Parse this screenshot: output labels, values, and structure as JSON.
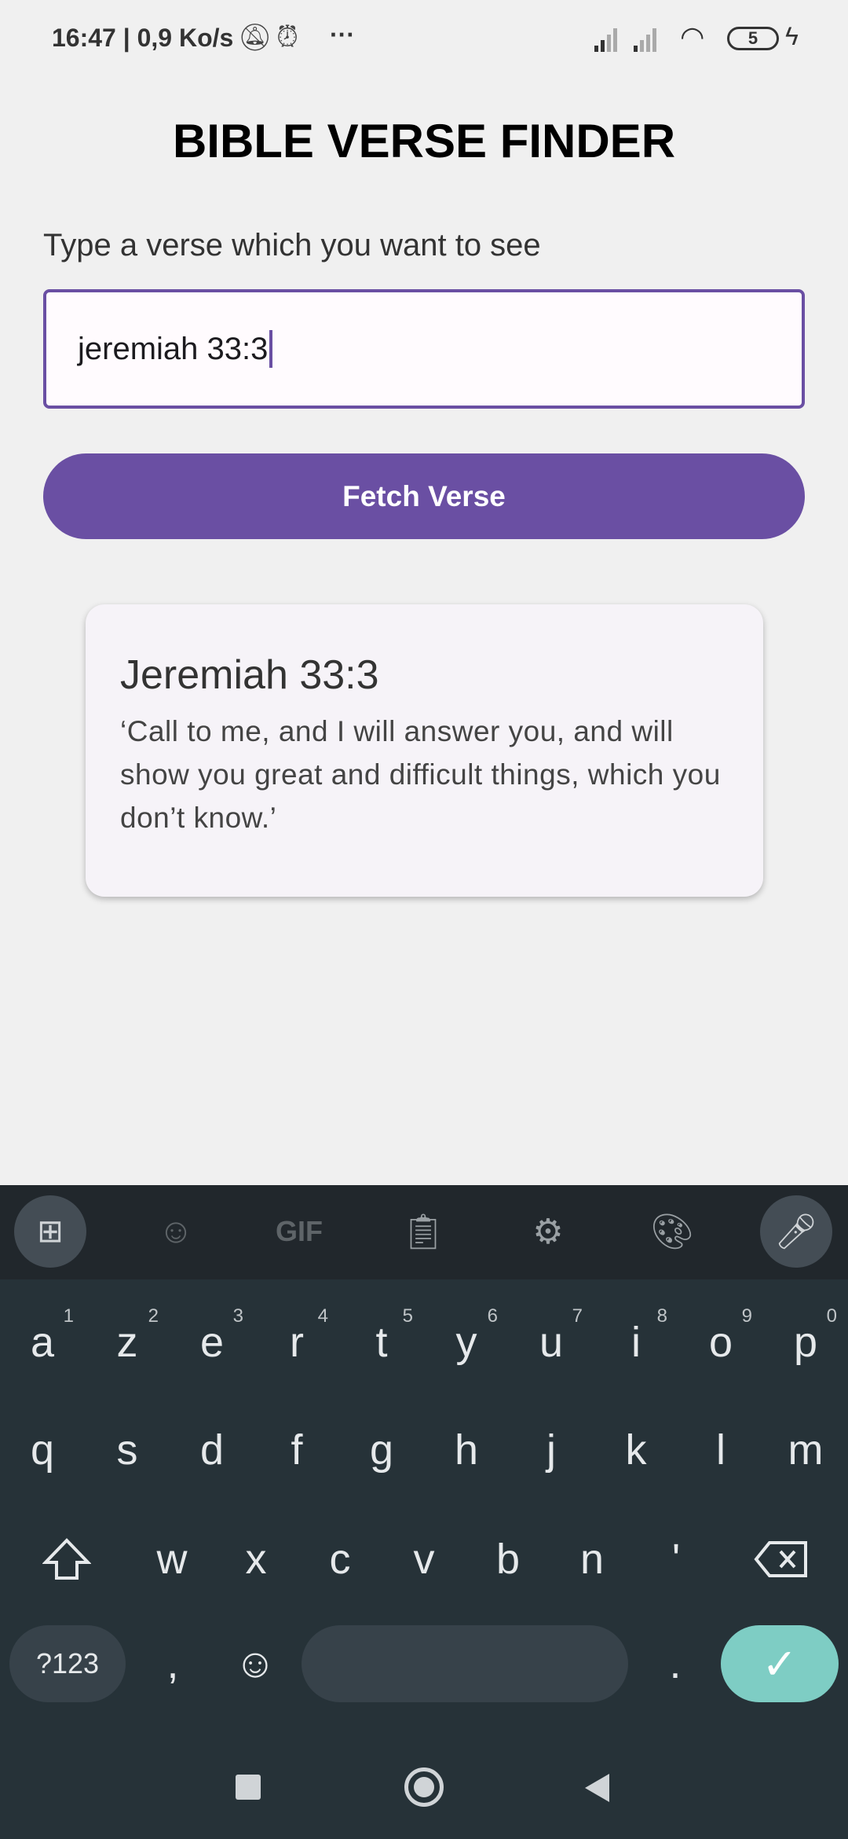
{
  "status_bar": {
    "time": "16:47 | 0,9 Ko/s",
    "more": "···",
    "battery": "5",
    "icons": [
      "mute-bell-icon",
      "alarm-icon",
      "signal-icon",
      "signal-icon",
      "wifi-icon",
      "battery-icon",
      "charging-icon"
    ]
  },
  "app": {
    "title": "BIBLE VERSE FINDER",
    "prompt": "Type a verse which you want to see",
    "input_value": "jeremiah 33:3",
    "button": "Fetch Verse",
    "accent": "#6a4fa3"
  },
  "verse": {
    "reference": "Jeremiah 33:3",
    "text": "‘Call to me, and I will answer you, and will show you great and difficult things, which you don’t know.’"
  },
  "keyboard": {
    "toolbar": [
      "apps-icon",
      "sticker-icon",
      "GIF",
      "clipboard-icon",
      "settings-icon",
      "palette-icon",
      "mic-icon"
    ],
    "row1": [
      "a",
      "z",
      "e",
      "r",
      "t",
      "y",
      "u",
      "i",
      "o",
      "p"
    ],
    "row1_hints": [
      "1",
      "2",
      "3",
      "4",
      "5",
      "6",
      "7",
      "8",
      "9",
      "0"
    ],
    "row2": [
      "q",
      "s",
      "d",
      "f",
      "g",
      "h",
      "j",
      "k",
      "l",
      "m"
    ],
    "row3": [
      "w",
      "x",
      "c",
      "v",
      "b",
      "n",
      "'"
    ],
    "symbols": "?123",
    "comma": ",",
    "period": ".",
    "enter_color": "#7ecdc4"
  }
}
